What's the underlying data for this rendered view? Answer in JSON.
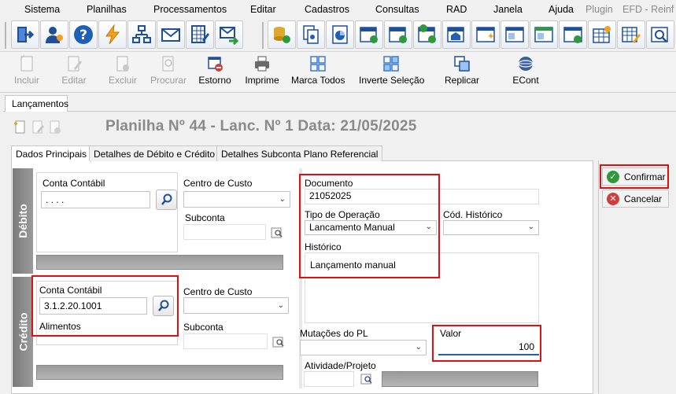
{
  "menu": {
    "items": [
      "Sistema",
      "Planilhas",
      "Processamentos",
      "Editar",
      "Cadastros",
      "Consultas",
      "RAD",
      "Janela",
      "Ajuda"
    ],
    "disabled_items": [
      "Plugin",
      "EFD - Reinf"
    ]
  },
  "actions": {
    "incluir": "Incluir",
    "editar": "Editar",
    "excluir": "Excluir",
    "procurar": "Procurar",
    "estorno": "Estorno",
    "imprime": "Imprime",
    "marca_todos": "Marca Todos",
    "inverte_selecao": "Inverte Seleção",
    "replicar": "Replicar",
    "econt": "ECont"
  },
  "window_tab": "Lançamentos",
  "title": "Planilha Nº 44 - Lanc. Nº 1 Data: 21/05/2025",
  "tabs": [
    "Dados Principais",
    "Detalhes de Débito e Crédito",
    "Detalhes Subconta Plano Referencial"
  ],
  "debito": {
    "strip_label": "Débito",
    "conta_label": "Conta Contábil",
    "conta_value": ". . . .",
    "centro_label": "Centro de Custo",
    "subconta_label": "Subconta"
  },
  "credito": {
    "strip_label": "Crédito",
    "conta_label": "Conta Contábil",
    "conta_value": "3.1.2.20.1001",
    "conta_desc": "Alimentos",
    "centro_label": "Centro de Custo",
    "subconta_label": "Subconta"
  },
  "documento": {
    "label": "Documento",
    "value": "21052025"
  },
  "tipo_operacao": {
    "label": "Tipo de Operação",
    "value": "Lancamento Manual"
  },
  "cod_historico": {
    "label": "Cód. Histórico",
    "value": ""
  },
  "historico": {
    "label": "Histórico",
    "value": "Lançamento manual"
  },
  "mutacoes": {
    "label": "Mutações do PL",
    "value": ""
  },
  "valor": {
    "label": "Valor",
    "value": "100"
  },
  "atividade": {
    "label": "Atividade/Projeto",
    "value": ""
  },
  "buttons": {
    "confirmar": "Confirmar",
    "cancelar": "Cancelar"
  },
  "colors": {
    "highlight": "#e01010",
    "confirm": "#2e9a3c",
    "cancel": "#d23c3c",
    "strip": "#8a8a8a"
  }
}
